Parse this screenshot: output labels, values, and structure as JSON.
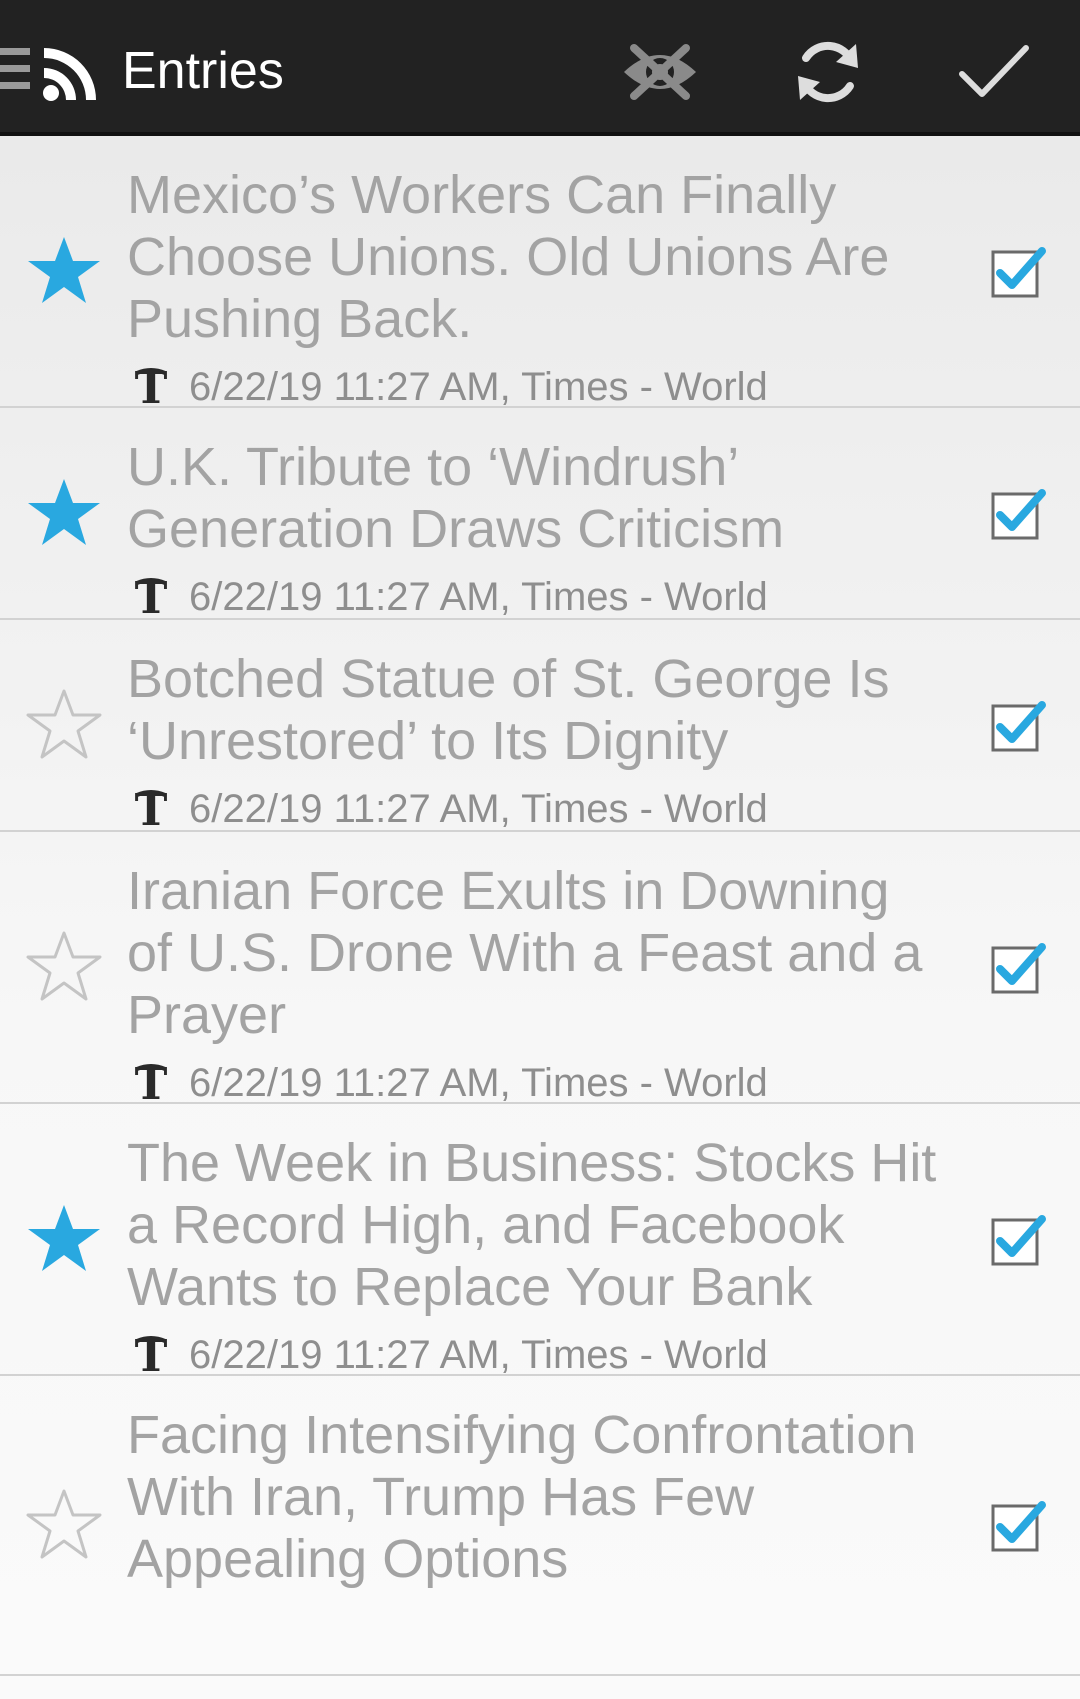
{
  "topbar": {
    "title": "Entries",
    "icons": {
      "menu": "hamburger-icon",
      "feed": "rss-icon",
      "hide": "eye-off-icon",
      "refresh": "refresh-icon",
      "mark_read": "checkmark-icon"
    }
  },
  "colors": {
    "topbar_bg": "#222222",
    "accent": "#29a8e0",
    "title_text": "#a3a3a3",
    "meta_text": "#8e8e8e"
  },
  "entries": [
    {
      "title": "Mexico’s Workers Can Finally Choose Unions. Old Unions Are Pushing Back.",
      "meta": "6/22/19 11:27 AM, Times - World",
      "starred": true,
      "checked": true
    },
    {
      "title": "U.K. Tribute to ‘Windrush’ Generation Draws Criticism",
      "meta": "6/22/19 11:27 AM, Times - World",
      "starred": true,
      "checked": true
    },
    {
      "title": "Botched Statue of St. George Is ‘Unrestored’ to Its Dignity",
      "meta": "6/22/19 11:27 AM, Times - World",
      "starred": false,
      "checked": true
    },
    {
      "title": "Iranian Force Exults in Downing of U.S. Drone With a Feast and a Prayer",
      "meta": "6/22/19 11:27 AM, Times - World",
      "starred": false,
      "checked": true
    },
    {
      "title": "The Week in Business: Stocks Hit a Record High, and Facebook Wants to Replace Your Bank",
      "meta": "6/22/19 11:27 AM, Times - World",
      "starred": true,
      "checked": true
    },
    {
      "title": "Facing Intensifying Confrontation With Iran, Trump Has Few Appealing Options",
      "meta": "",
      "starred": false,
      "checked": true
    }
  ]
}
